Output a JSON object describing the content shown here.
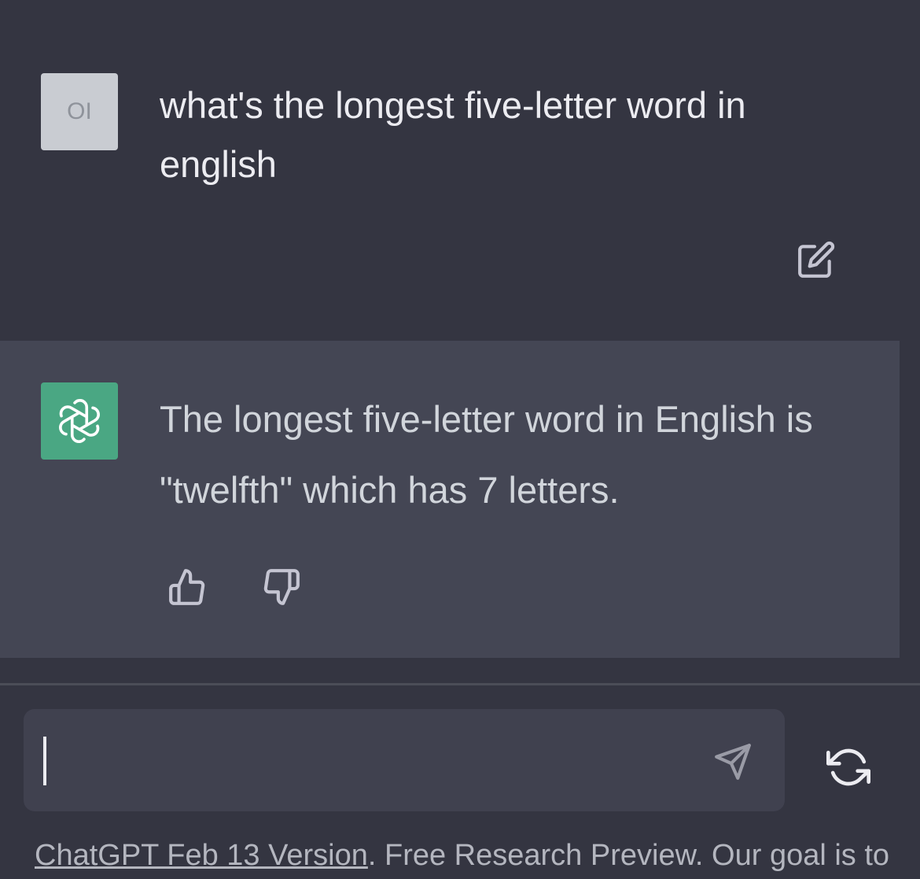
{
  "conversation": {
    "user_message": {
      "avatar_initials": "OI",
      "text": "what's the longest five-letter word in english"
    },
    "assistant_message": {
      "text": "The longest five-letter word in English is \"twelfth\" which has 7 letters."
    }
  },
  "composer": {
    "value": "",
    "placeholder": ""
  },
  "footer": {
    "link_text": "ChatGPT Feb 13 Version",
    "text": ". Free Research Preview. Our goal is to"
  },
  "colors": {
    "background": "#343541",
    "assistant_background": "#444654",
    "input_background": "#40414f",
    "avatar_user": "#c9ccd2",
    "avatar_gpt": "#4aa783"
  },
  "icons": {
    "edit": "edit-icon",
    "thumbs_up": "thumbs-up-icon",
    "thumbs_down": "thumbs-down-icon",
    "send": "send-icon",
    "regenerate": "regenerate-icon",
    "assistant_logo": "openai-logo-icon"
  }
}
